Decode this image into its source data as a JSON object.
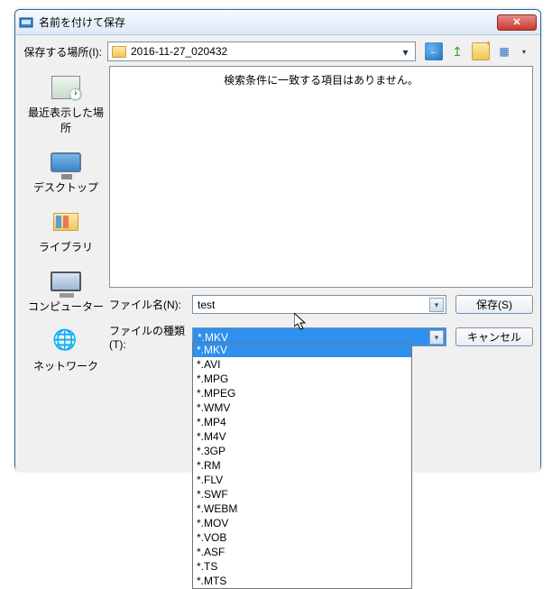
{
  "title": "名前を付けて保存",
  "toprow": {
    "label": "保存する場所(I):",
    "folder": "2016-11-27_020432"
  },
  "empty_msg": "検索条件に一致する項目はありません。",
  "places": {
    "recent": "最近表示した場所",
    "desktop": "デスクトップ",
    "libraries": "ライブラリ",
    "computer": "コンピューター",
    "network": "ネットワーク"
  },
  "filename": {
    "label": "ファイル名(N):",
    "value": "test"
  },
  "filetype": {
    "label": "ファイルの種類(T):",
    "value": "*.MKV"
  },
  "buttons": {
    "save": "保存(S)",
    "cancel": "キャンセル"
  },
  "dropdown": [
    "*.MKV",
    "*.AVI",
    "*.MPG",
    "*.MPEG",
    "*.WMV",
    "*.MP4",
    "*.M4V",
    "*.3GP",
    "*.RM",
    "*.FLV",
    "*.SWF",
    "*.WEBM",
    "*.MOV",
    "*.VOB",
    "*.ASF",
    "*.TS",
    "*.MTS"
  ],
  "dropdown_selected": 0
}
